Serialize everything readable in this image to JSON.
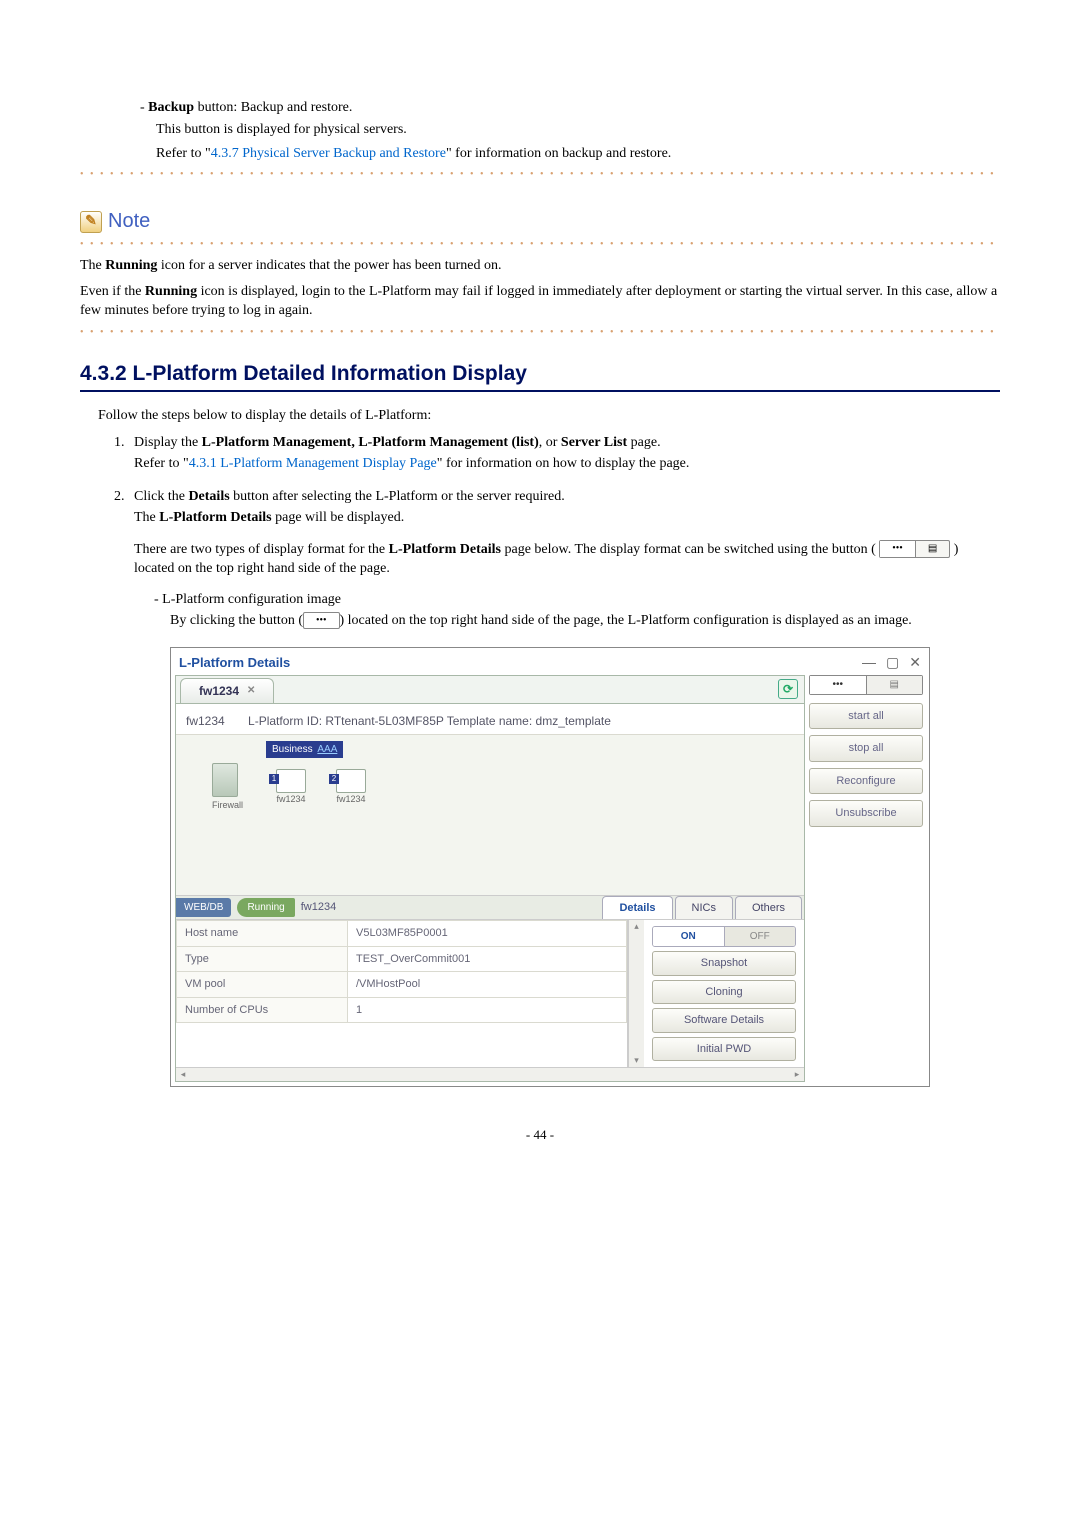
{
  "intro": {
    "backup_line": "- ",
    "backup_bold": "Backup",
    "backup_rest": " button: Backup and restore.",
    "backup_sub1": "This button is displayed for physical servers.",
    "backup_sub2a": "Refer to \"",
    "backup_link": "4.3.7 Physical Server Backup and Restore",
    "backup_sub2b": "\" for information on backup and restore."
  },
  "note": {
    "label": "Note",
    "p1a": "The ",
    "p1b": "Running",
    "p1c": " icon for a server indicates that the power has been turned on.",
    "p2a": "Even if the ",
    "p2b": "Running",
    "p2c": " icon is displayed, login to the L-Platform may fail if logged in immediately after deployment or starting the virtual server. In this case, allow a few minutes before trying to log in again."
  },
  "section": {
    "title": "4.3.2  L-Platform Detailed Information Display",
    "lead": "Follow the steps below to display the details of L-Platform:"
  },
  "step1": {
    "a": "Display the ",
    "b": "L-Platform Management, L-Platform Management (list)",
    "c": ", or ",
    "d": "Server List",
    "e": " page.",
    "ref_a": "Refer to \"",
    "ref_link": "4.3.1 L-Platform Management Display Page",
    "ref_b": "\" for information on how to display the page."
  },
  "step2": {
    "a": "Click the ",
    "b": "Details",
    "c": " button after selecting the L-Platform or the server required.",
    "d": "The ",
    "e": "L-Platform Details",
    "f": " page will be displayed.",
    "p2a": "There are two types of display format for the ",
    "p2b": "L-Platform Details",
    "p2c": " page below. The display format can be switched using the button (",
    "p2d": ") located on the top right hand side of the page.",
    "cfg_title": "-  L-Platform configuration image",
    "cfg_a": "By clicking the button (",
    "cfg_b": ") located on the top right hand side of the page, the L-Platform configuration is displayed as an image."
  },
  "toggle": {
    "l": "•••",
    "r": "▤"
  },
  "shot": {
    "title": "L-Platform Details",
    "tab": "fw1234",
    "info_name": "fw1234",
    "info_mid": "L-Platform ID: RTtenant-5L03MF85P   Template name: dmz_template",
    "biz": "Business",
    "biz_link": "AAA",
    "firewall": "Firewall",
    "node1": "fw1234",
    "node2": "fw1234",
    "webdb": "WEB/DB",
    "running": "Running",
    "server": "fw1234",
    "tabs": {
      "details": "Details",
      "nics": "NICs",
      "others": "Others"
    },
    "on": "ON",
    "off": "OFF",
    "side": {
      "snapshot": "Snapshot",
      "cloning": "Cloning",
      "soft": "Software Details",
      "pwd": "Initial PWD"
    },
    "right": {
      "start": "start all",
      "stop": "stop all",
      "reconf": "Reconfigure",
      "unsub": "Unsubscribe"
    },
    "props": {
      "r1k": "Host name",
      "r1v": "V5L03MF85P0001",
      "r2k": "Type",
      "r2v": "TEST_OverCommit001",
      "r3k": "VM pool",
      "r3v": "/VMHostPool",
      "r4k": "Number of CPUs",
      "r4v": "1"
    }
  },
  "page": "- 44 -"
}
